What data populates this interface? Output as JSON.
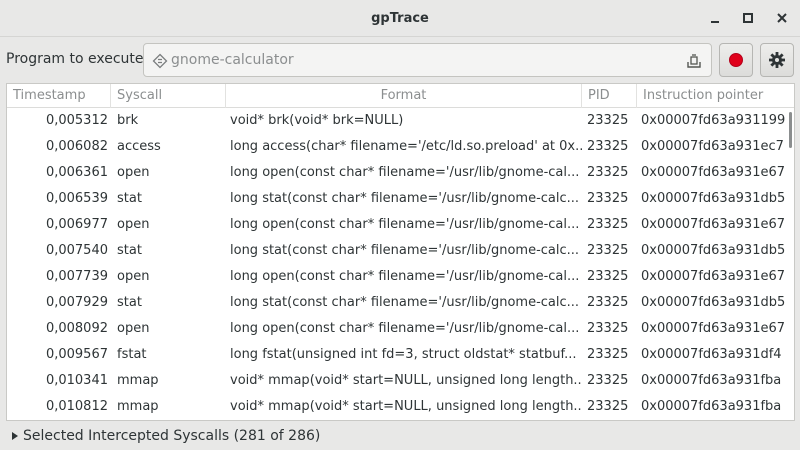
{
  "window": {
    "title": "gpTrace",
    "controls": [
      "minimize",
      "maximize",
      "close"
    ]
  },
  "toolbar": {
    "program_label": "Program to execute:",
    "program_placeholder": "gnome-calculator",
    "program_value": "",
    "record_icon": "record-icon",
    "settings_icon": "gear-icon",
    "record_color": "#e0001b"
  },
  "table": {
    "headers": [
      "Timestamp",
      "Syscall",
      "Format",
      "PID",
      "Instruction pointer"
    ],
    "rows": [
      [
        "0,005312",
        "brk",
        "void* brk(void* brk=NULL)",
        "23325",
        "0x00007fd63a931199"
      ],
      [
        "0,006082",
        "access",
        "long access(char* filename='/etc/ld.so.preload' at 0x...",
        "23325",
        "0x00007fd63a931ec7"
      ],
      [
        "0,006361",
        "open",
        "long open(const char* filename='/usr/lib/gnome-cal...",
        "23325",
        "0x00007fd63a931e67"
      ],
      [
        "0,006539",
        "stat",
        "long stat(const char* filename='/usr/lib/gnome-calc...",
        "23325",
        "0x00007fd63a931db5"
      ],
      [
        "0,006977",
        "open",
        "long open(const char* filename='/usr/lib/gnome-cal...",
        "23325",
        "0x00007fd63a931e67"
      ],
      [
        "0,007540",
        "stat",
        "long stat(const char* filename='/usr/lib/gnome-calc...",
        "23325",
        "0x00007fd63a931db5"
      ],
      [
        "0,007739",
        "open",
        "long open(const char* filename='/usr/lib/gnome-cal...",
        "23325",
        "0x00007fd63a931e67"
      ],
      [
        "0,007929",
        "stat",
        "long stat(const char* filename='/usr/lib/gnome-calc...",
        "23325",
        "0x00007fd63a931db5"
      ],
      [
        "0,008092",
        "open",
        "long open(const char* filename='/usr/lib/gnome-cal...",
        "23325",
        "0x00007fd63a931e67"
      ],
      [
        "0,009567",
        "fstat",
        "long fstat(unsigned int fd=3, struct oldstat* statbuf...",
        "23325",
        "0x00007fd63a931df4"
      ],
      [
        "0,010341",
        "mmap",
        "void* mmap(void* start=NULL, unsigned long length...",
        "23325",
        "0x00007fd63a931fba"
      ],
      [
        "0,010812",
        "mmap",
        "void* mmap(void* start=NULL, unsigned long length...",
        "23325",
        "0x00007fd63a931fba"
      ]
    ]
  },
  "footer": {
    "expander_label": "Selected Intercepted Syscalls (281 of 286)",
    "expander_icon": "triangle-right-icon"
  }
}
